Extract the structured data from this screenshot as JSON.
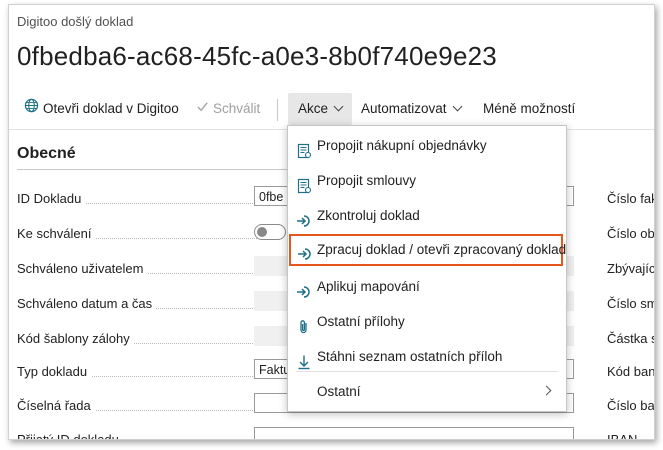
{
  "page": {
    "subtitle": "Digitoo došlý doklad",
    "title": "0fbedba6-ac68-45fc-a0e3-8b0f740e9e23"
  },
  "toolbar": {
    "open_in_digitoo": "Otevři doklad v Digitoo",
    "approve": "Schválit",
    "actions": "Akce",
    "automate": "Automatizovat",
    "fewer_options": "Méně možností"
  },
  "section": {
    "title": "Obecné"
  },
  "fields": {
    "id_dokladu": {
      "label": "ID Dokladu",
      "value": "0fbe"
    },
    "ke_schvaleni": {
      "label": "Ke schválení"
    },
    "schvaleno_uzivatelem": {
      "label": "Schváleno uživatelem"
    },
    "schvaleno_datum": {
      "label": "Schváleno datum a čas"
    },
    "kod_sablony": {
      "label": "Kód šablony zálohy"
    },
    "typ_dokladu": {
      "label": "Typ dokladu",
      "value": "Faktu"
    },
    "ciselna_rada": {
      "label": "Číselná řada"
    },
    "partial": {
      "label": "Přijatý ID dokladu"
    }
  },
  "right_labels": {
    "r1": "Číslo fak",
    "r2": "Číslo obj",
    "r3": "Zbývající",
    "r4": "Číslo sm",
    "r5": "Částka s",
    "r6": "Kód ban",
    "r7": "Číslo ban",
    "r8": "IBAN"
  },
  "menu": {
    "items": [
      {
        "label": "Propojit nákupní objednávky",
        "icon": "link-document-icon"
      },
      {
        "label": "Propojit smlouvy",
        "icon": "link-document-icon"
      },
      {
        "label": "Zkontroluj doklad",
        "icon": "process-arrow-icon"
      },
      {
        "label": "Zpracuj doklad / otevři zpracovaný doklad",
        "icon": "process-arrow-icon"
      },
      {
        "label": "Aplikuj mapování",
        "icon": "process-arrow-icon"
      },
      {
        "label": "Ostatní přílohy",
        "icon": "paperclip-icon"
      },
      {
        "label": "Stáhni seznam ostatních příloh",
        "icon": "download-icon"
      },
      {
        "label": "Ostatní",
        "icon": "chevron-right-icon"
      }
    ]
  },
  "colors": {
    "highlight": "#e8561b",
    "menu_icon": "#1f6f8b",
    "globe": "#1f6f8b"
  }
}
